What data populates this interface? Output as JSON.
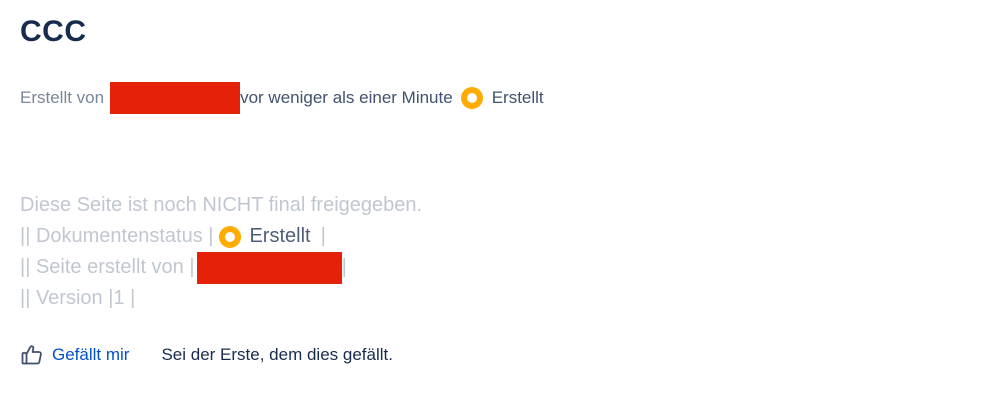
{
  "page": {
    "title": "CCC"
  },
  "byline": {
    "created_by_label": "Erstellt von",
    "time_text": "vor weniger als einer Minute",
    "status_icon": "status-circle-icon",
    "status_text": "Erstellt",
    "status_color": "#FFAB00"
  },
  "content": {
    "notice": "Diese Seite ist noch NICHT final freigegeben.",
    "doc_status_label": "|| Dokumentenstatus |",
    "doc_status_value": "Erstellt",
    "doc_status_end": "|",
    "created_by_row": "|| Seite erstellt von |",
    "created_by_end": "|",
    "version_row": "|| Version |1 |"
  },
  "reactions": {
    "like_label": "Gefällt mir",
    "like_icon": "thumbs-up-icon",
    "summary": "Sei der Erste, dem dies gefällt."
  },
  "colors": {
    "title": "#172B4D",
    "link": "#0052CC",
    "redaction": "#E52207",
    "muted_content": "#C1C7D0"
  }
}
